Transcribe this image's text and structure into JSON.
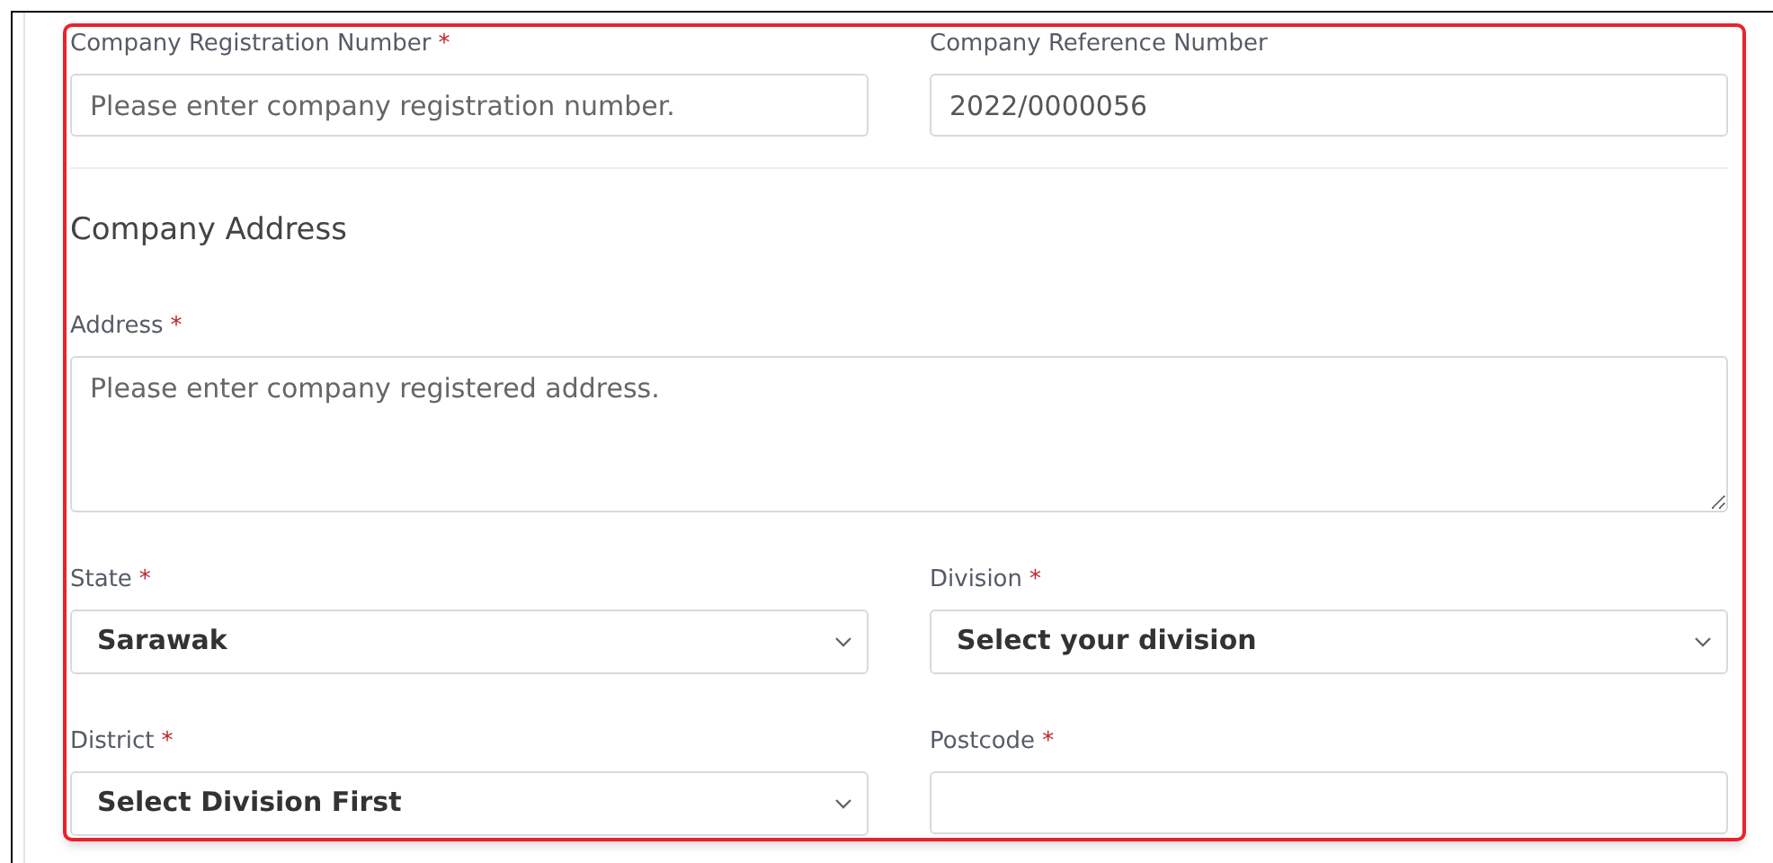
{
  "rows": [
    {
      "fields": [
        {
          "kind": "input",
          "label": "Company Registration Number",
          "required_mark": "*",
          "placeholder": "Please enter company registration number."
        },
        {
          "kind": "input",
          "label": "Company Reference Number",
          "value": "2022/0000056"
        }
      ]
    }
  ],
  "section_title": "Company Address",
  "address": {
    "kind": "textarea",
    "label": "Address",
    "required_mark": "*",
    "placeholder": "Please enter company registered address."
  },
  "rows_after": [
    {
      "fields": [
        {
          "kind": "select",
          "label": "State",
          "required_mark": "*",
          "value": "Sarawak"
        },
        {
          "kind": "select",
          "label": "Division",
          "required_mark": "*",
          "value": "Select your division"
        }
      ]
    },
    {
      "fields": [
        {
          "kind": "select",
          "label": "District",
          "required_mark": "*",
          "value": "Select Division First"
        },
        {
          "kind": "input",
          "label": "Postcode",
          "required_mark": "*"
        }
      ]
    }
  ]
}
